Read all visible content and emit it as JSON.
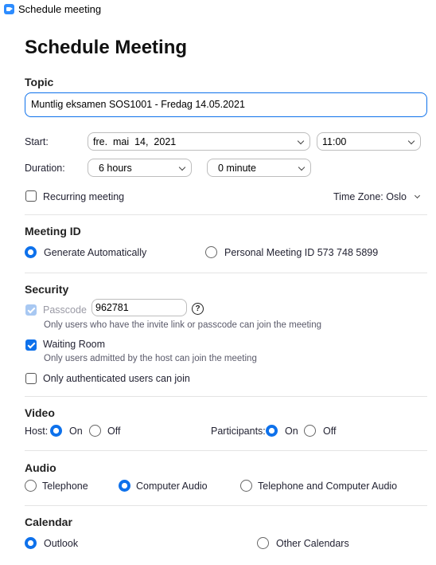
{
  "window": {
    "title": "Schedule meeting"
  },
  "heading": "Schedule Meeting",
  "topic": {
    "label": "Topic",
    "value": "Muntlig eksamen SOS1001 - Fredag 14.05.2021"
  },
  "start": {
    "label": "Start:",
    "date": "fre.  mai  14,  2021",
    "time": "11:00"
  },
  "duration": {
    "label": "Duration:",
    "hours": "6 hours",
    "minutes": "0 minute"
  },
  "recurring": {
    "label": "Recurring meeting",
    "checked": false
  },
  "timezone": {
    "label": "Time Zone: Oslo"
  },
  "meeting_id": {
    "title": "Meeting ID",
    "auto_label": "Generate Automatically",
    "personal_label": "Personal Meeting ID 573 748 5899",
    "selected": "auto"
  },
  "security": {
    "title": "Security",
    "passcode_label": "Passcode",
    "passcode_value": "962781",
    "passcode_help": "?",
    "passcode_desc": "Only users who have the invite link or passcode can join the meeting",
    "waiting_label": "Waiting Room",
    "waiting_desc": "Only users admitted by the host can join the meeting",
    "auth_label": "Only authenticated users can join"
  },
  "video": {
    "title": "Video",
    "host_label": "Host:",
    "participants_label": "Participants:",
    "on": "On",
    "off": "Off",
    "host": "on",
    "participants": "on"
  },
  "audio": {
    "title": "Audio",
    "telephone": "Telephone",
    "computer": "Computer Audio",
    "both": "Telephone and Computer Audio",
    "selected": "computer"
  },
  "calendar": {
    "title": "Calendar",
    "outlook": "Outlook",
    "other": "Other Calendars",
    "selected": "outlook"
  },
  "colors": {
    "accent": "#0e71eb",
    "text": "#232333"
  }
}
